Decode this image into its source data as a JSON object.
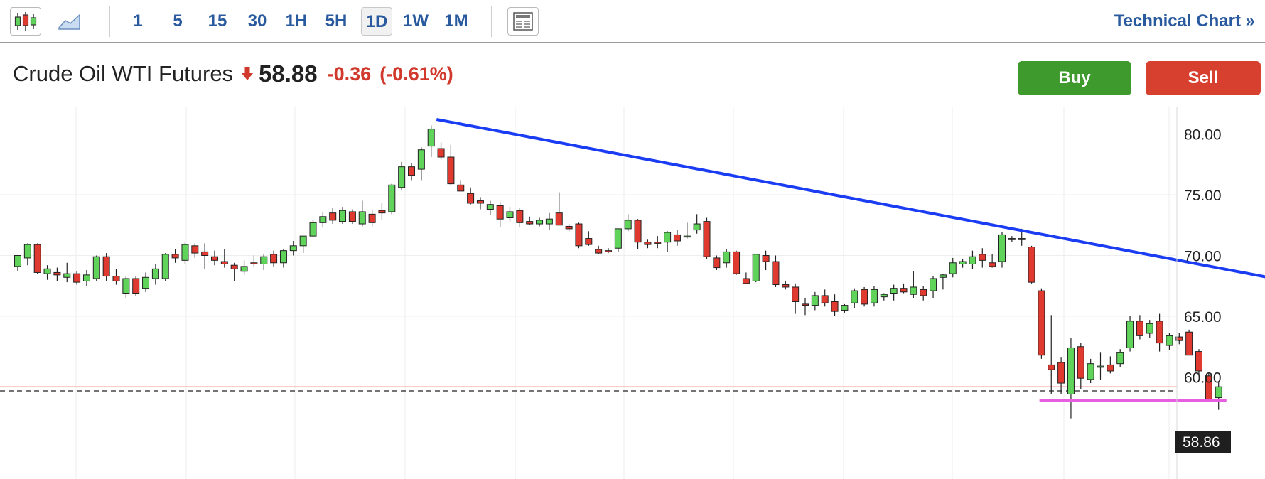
{
  "toolbar": {
    "candlestick_icon": "candlestick-icon",
    "area_icon": "area-chart-icon",
    "timeframes": [
      "1",
      "5",
      "15",
      "30",
      "1H",
      "5H",
      "1D",
      "1W",
      "1M"
    ],
    "active_timeframe": "1D",
    "layout_icon": "news-layout-icon",
    "technical_link": "Technical Chart",
    "technical_link_glyph": "»"
  },
  "quote": {
    "name": "Crude Oil WTI Futures",
    "direction_icon": "down-arrow-icon",
    "price": "58.88",
    "change": "-0.36",
    "change_pct": "(-0.61%)"
  },
  "actions": {
    "buy": "Buy",
    "sell": "Sell"
  },
  "colors": {
    "up": "#5fd35a",
    "down": "#e0392f",
    "trendline": "#1a3cf2",
    "support": "#e85ee0",
    "link": "#2a5a9e",
    "buy": "#3e9a2c",
    "sell": "#d7402f"
  },
  "chart_data": {
    "type": "candlestick",
    "y_ticks": [
      "80.00",
      "75.00",
      "70.00",
      "65.00",
      "60.00"
    ],
    "ylim": [
      56,
      83
    ],
    "grid": true,
    "last_price_label": "58.86",
    "last_price": 58.86,
    "current_line": 59.2,
    "candles": [
      [
        69.1,
        70.0,
        68.7,
        70.0
      ],
      [
        69.8,
        71.0,
        69.2,
        70.9
      ],
      [
        70.9,
        71.0,
        68.5,
        68.6
      ],
      [
        68.5,
        69.2,
        68.0,
        68.9
      ],
      [
        68.6,
        69.0,
        67.9,
        68.4
      ],
      [
        68.2,
        69.4,
        67.8,
        68.5
      ],
      [
        68.5,
        68.7,
        67.6,
        67.8
      ],
      [
        67.9,
        68.8,
        67.5,
        68.4
      ],
      [
        68.1,
        70.0,
        67.9,
        69.9
      ],
      [
        69.9,
        70.2,
        67.9,
        68.3
      ],
      [
        68.3,
        68.9,
        67.6,
        67.9
      ],
      [
        66.9,
        68.3,
        66.5,
        68.1
      ],
      [
        68.1,
        68.3,
        66.7,
        66.9
      ],
      [
        67.3,
        68.6,
        67.0,
        68.2
      ],
      [
        68.1,
        69.3,
        67.6,
        68.9
      ],
      [
        68.1,
        70.2,
        67.9,
        70.1
      ],
      [
        70.1,
        70.5,
        69.4,
        69.8
      ],
      [
        69.6,
        71.1,
        69.3,
        70.9
      ],
      [
        70.8,
        71.0,
        69.8,
        70.2
      ],
      [
        70.3,
        71.0,
        68.9,
        70.0
      ],
      [
        69.9,
        70.4,
        69.2,
        69.6
      ],
      [
        69.5,
        70.5,
        69.0,
        69.3
      ],
      [
        69.2,
        69.4,
        67.9,
        68.9
      ],
      [
        68.7,
        69.6,
        68.4,
        69.1
      ],
      [
        69.4,
        70.0,
        69.1,
        69.3
      ],
      [
        69.3,
        70.1,
        68.8,
        69.9
      ],
      [
        70.1,
        70.4,
        69.1,
        69.4
      ],
      [
        69.4,
        70.5,
        69.0,
        70.4
      ],
      [
        70.4,
        71.2,
        70.0,
        70.8
      ],
      [
        70.8,
        71.4,
        70.2,
        71.6
      ],
      [
        71.6,
        72.9,
        71.5,
        72.7
      ],
      [
        72.7,
        73.6,
        72.3,
        73.2
      ],
      [
        73.5,
        73.9,
        72.6,
        72.9
      ],
      [
        72.8,
        74.0,
        72.6,
        73.7
      ],
      [
        73.6,
        73.8,
        72.6,
        72.8
      ],
      [
        72.6,
        74.5,
        72.4,
        73.6
      ],
      [
        73.4,
        73.8,
        72.4,
        72.7
      ],
      [
        73.7,
        74.3,
        72.9,
        73.5
      ],
      [
        73.6,
        75.9,
        73.4,
        75.8
      ],
      [
        75.6,
        77.7,
        75.4,
        77.3
      ],
      [
        77.3,
        77.6,
        76.2,
        76.6
      ],
      [
        77.1,
        78.9,
        76.2,
        78.7
      ],
      [
        79.0,
        80.7,
        78.1,
        80.4
      ],
      [
        78.8,
        79.3,
        77.9,
        78.1
      ],
      [
        78.1,
        79.1,
        75.8,
        75.9
      ],
      [
        75.8,
        76.2,
        75.3,
        75.3
      ],
      [
        75.1,
        75.6,
        74.2,
        74.3
      ],
      [
        74.5,
        74.8,
        73.8,
        74.3
      ],
      [
        73.8,
        74.5,
        73.3,
        74.2
      ],
      [
        74.1,
        74.4,
        72.3,
        73.0
      ],
      [
        73.1,
        74.0,
        72.8,
        73.6
      ],
      [
        73.7,
        73.9,
        72.3,
        72.7
      ],
      [
        72.8,
        73.2,
        72.5,
        72.6
      ],
      [
        72.6,
        73.1,
        72.4,
        72.9
      ],
      [
        72.6,
        73.5,
        72.1,
        73.0
      ],
      [
        73.5,
        75.2,
        72.5,
        72.5
      ],
      [
        72.4,
        72.6,
        72.0,
        72.2
      ],
      [
        72.6,
        72.7,
        70.6,
        70.8
      ],
      [
        71.4,
        72.0,
        70.8,
        70.9
      ],
      [
        70.5,
        70.8,
        70.1,
        70.2
      ],
      [
        70.4,
        70.6,
        70.2,
        70.3
      ],
      [
        70.6,
        72.0,
        70.3,
        72.2
      ],
      [
        72.2,
        73.4,
        72.0,
        72.9
      ],
      [
        72.9,
        73.0,
        70.5,
        71.1
      ],
      [
        71.1,
        71.3,
        70.6,
        70.9
      ],
      [
        71.1,
        71.6,
        70.6,
        71.0
      ],
      [
        71.1,
        72.0,
        70.3,
        71.9
      ],
      [
        71.7,
        72.1,
        70.8,
        71.2
      ],
      [
        71.6,
        72.7,
        71.4,
        71.6
      ],
      [
        72.1,
        73.4,
        71.8,
        72.6
      ],
      [
        72.8,
        73.1,
        69.7,
        69.9
      ],
      [
        69.8,
        70.0,
        68.8,
        69.0
      ],
      [
        69.4,
        70.5,
        69.0,
        70.3
      ],
      [
        70.3,
        70.4,
        68.4,
        68.5
      ],
      [
        68.1,
        68.6,
        67.7,
        67.7
      ],
      [
        67.9,
        70.1,
        67.8,
        70.1
      ],
      [
        70.0,
        70.4,
        68.8,
        69.5
      ],
      [
        69.5,
        70.0,
        67.4,
        67.6
      ],
      [
        67.6,
        67.9,
        67.2,
        67.4
      ],
      [
        67.4,
        67.7,
        65.2,
        66.2
      ],
      [
        66.0,
        66.5,
        65.1,
        65.9
      ],
      [
        65.9,
        67.0,
        65.5,
        66.7
      ],
      [
        66.7,
        67.2,
        65.8,
        66.1
      ],
      [
        66.2,
        66.8,
        65.0,
        65.4
      ],
      [
        65.5,
        66.0,
        65.3,
        65.9
      ],
      [
        66.1,
        67.3,
        65.7,
        67.1
      ],
      [
        67.2,
        67.4,
        65.8,
        66.0
      ],
      [
        66.1,
        67.5,
        65.8,
        67.2
      ],
      [
        66.6,
        66.9,
        66.3,
        66.8
      ],
      [
        66.9,
        67.6,
        66.3,
        67.3
      ],
      [
        67.3,
        67.7,
        66.9,
        67.0
      ],
      [
        66.8,
        68.7,
        66.5,
        67.4
      ],
      [
        67.2,
        67.5,
        66.3,
        66.7
      ],
      [
        67.1,
        68.3,
        66.5,
        68.1
      ],
      [
        68.2,
        68.5,
        67.2,
        68.4
      ],
      [
        68.5,
        69.8,
        68.2,
        69.4
      ],
      [
        69.3,
        69.7,
        69.0,
        69.5
      ],
      [
        69.3,
        70.4,
        68.9,
        69.9
      ],
      [
        70.1,
        70.6,
        69.0,
        69.6
      ],
      [
        69.4,
        70.1,
        69.0,
        69.1
      ],
      [
        69.5,
        71.9,
        69.0,
        71.7
      ],
      [
        71.4,
        71.6,
        71.1,
        71.3
      ],
      [
        71.3,
        72.2,
        70.8,
        71.4
      ],
      [
        70.7,
        70.8,
        67.7,
        67.8
      ],
      [
        67.1,
        67.3,
        61.5,
        61.8
      ],
      [
        61.0,
        65.1,
        58.6,
        60.6
      ],
      [
        61.2,
        61.6,
        58.6,
        59.5
      ],
      [
        58.6,
        63.2,
        56.6,
        62.4
      ],
      [
        62.5,
        62.8,
        59.0,
        59.9
      ],
      [
        59.8,
        61.5,
        59.5,
        61.1
      ],
      [
        60.8,
        62.0,
        59.8,
        60.9
      ],
      [
        61.0,
        61.7,
        60.3,
        60.5
      ],
      [
        61.1,
        62.3,
        60.8,
        62.0
      ],
      [
        62.4,
        65.0,
        62.1,
        64.6
      ],
      [
        64.6,
        65.1,
        63.1,
        63.4
      ],
      [
        63.6,
        64.7,
        63.2,
        64.4
      ],
      [
        64.6,
        65.2,
        62.1,
        62.8
      ],
      [
        62.6,
        63.6,
        62.2,
        63.4
      ],
      [
        63.3,
        63.6,
        62.7,
        63.0
      ],
      [
        63.7,
        63.9,
        61.8,
        61.8
      ],
      [
        62.1,
        62.3,
        60.2,
        60.5
      ],
      [
        60.1,
        60.3,
        58.0,
        58.1
      ],
      [
        58.3,
        59.6,
        57.3,
        59.2
      ]
    ],
    "trendline": {
      "start": [
        42.55,
        81.2
      ],
      "end": [
        127.7,
        68.1
      ]
    },
    "support_line": {
      "start": [
        103.8,
        58.05
      ],
      "end": [
        122.8,
        58.05
      ]
    }
  }
}
